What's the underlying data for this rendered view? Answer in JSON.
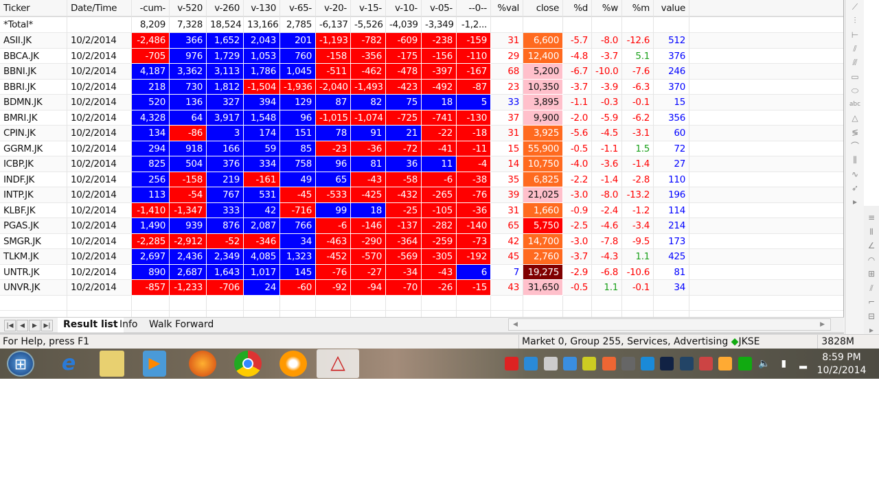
{
  "columns": [
    "Ticker",
    "Date/Time",
    "-cum-",
    "v-520",
    "v-260",
    "v-130",
    "v-65-",
    "v-20-",
    "v-15-",
    "v-10-",
    "v-05-",
    "--0--",
    "%val",
    "close",
    "%d",
    "%w",
    "%m",
    "value"
  ],
  "total": {
    "label": "*Total*",
    "values": [
      "8,209",
      "7,328",
      "18,524",
      "13,166",
      "2,785",
      "-6,137",
      "-5,526",
      "-4,039",
      "-3,349",
      "-1,2..."
    ]
  },
  "colors": {
    "positive_bg": "#0000ff",
    "negative_bg": "#ff0000",
    "orange": "#ff6a1f",
    "pink": "#ffc0cb",
    "red": "#ff0000",
    "darkred": "#800000",
    "blue_text": "#0000ff",
    "red_text": "#ff0000",
    "green_text": "#1aa01a"
  },
  "rows": [
    {
      "ticker": "ASII.JK",
      "date": "10/2/2014",
      "v": [
        "-2,486",
        "366",
        "1,652",
        "2,043",
        "201",
        "-1,193",
        "-782",
        "-609",
        "-238",
        "-159"
      ],
      "pval": "31",
      "pval_color": "red",
      "close": "6,600",
      "close_bg": "orange",
      "d": "-5.7",
      "w": "-8.0",
      "m": "-12.6",
      "value": "512"
    },
    {
      "ticker": "BBCA.JK",
      "date": "10/2/2014",
      "v": [
        "-705",
        "976",
        "1,729",
        "1,053",
        "760",
        "-158",
        "-356",
        "-175",
        "-156",
        "-110"
      ],
      "pval": "29",
      "pval_color": "red",
      "close": "12,400",
      "close_bg": "orange",
      "d": "-4.8",
      "w": "-3.7",
      "m": "5.1",
      "value": "376"
    },
    {
      "ticker": "BBNI.JK",
      "date": "10/2/2014",
      "v": [
        "4,187",
        "3,362",
        "3,113",
        "1,786",
        "1,045",
        "-511",
        "-462",
        "-478",
        "-397",
        "-167"
      ],
      "pval": "68",
      "pval_color": "red",
      "close": "5,200",
      "close_bg": "pink",
      "d": "-6.7",
      "w": "-10.0",
      "m": "-7.6",
      "value": "246"
    },
    {
      "ticker": "BBRI.JK",
      "date": "10/2/2014",
      "v": [
        "218",
        "730",
        "1,812",
        "-1,504",
        "-1,936",
        "-2,040",
        "-1,493",
        "-423",
        "-492",
        "-87"
      ],
      "pval": "23",
      "pval_color": "red",
      "close": "10,350",
      "close_bg": "pink",
      "d": "-3.7",
      "w": "-3.9",
      "m": "-6.3",
      "value": "370"
    },
    {
      "ticker": "BDMN.JK",
      "date": "10/2/2014",
      "v": [
        "520",
        "136",
        "327",
        "394",
        "129",
        "87",
        "82",
        "75",
        "18",
        "5"
      ],
      "pval": "33",
      "pval_color": "blue",
      "close": "3,895",
      "close_bg": "pink",
      "d": "-1.1",
      "w": "-0.3",
      "m": "-0.1",
      "value": "15"
    },
    {
      "ticker": "BMRI.JK",
      "date": "10/2/2014",
      "v": [
        "4,328",
        "64",
        "3,917",
        "1,548",
        "96",
        "-1,015",
        "-1,074",
        "-725",
        "-741",
        "-130"
      ],
      "pval": "37",
      "pval_color": "red",
      "close": "9,900",
      "close_bg": "pink",
      "d": "-2.0",
      "w": "-5.9",
      "m": "-6.2",
      "value": "356"
    },
    {
      "ticker": "CPIN.JK",
      "date": "10/2/2014",
      "v": [
        "134",
        "-86",
        "3",
        "174",
        "151",
        "78",
        "91",
        "21",
        "-22",
        "-18"
      ],
      "pval": "31",
      "pval_color": "red",
      "close": "3,925",
      "close_bg": "orange",
      "d": "-5.6",
      "w": "-4.5",
      "m": "-3.1",
      "value": "60"
    },
    {
      "ticker": "GGRM.JK",
      "date": "10/2/2014",
      "v": [
        "294",
        "918",
        "166",
        "59",
        "85",
        "-23",
        "-36",
        "-72",
        "-41",
        "-11"
      ],
      "pval": "15",
      "pval_color": "red",
      "close": "55,900",
      "close_bg": "orange",
      "d": "-0.5",
      "w": "-1.1",
      "m": "1.5",
      "value": "72"
    },
    {
      "ticker": "ICBP.JK",
      "date": "10/2/2014",
      "v": [
        "825",
        "504",
        "376",
        "334",
        "758",
        "96",
        "81",
        "36",
        "11",
        "-4"
      ],
      "pval": "14",
      "pval_color": "red",
      "close": "10,750",
      "close_bg": "orange",
      "d": "-4.0",
      "w": "-3.6",
      "m": "-1.4",
      "value": "27"
    },
    {
      "ticker": "INDF.JK",
      "date": "10/2/2014",
      "v": [
        "256",
        "-158",
        "219",
        "-161",
        "49",
        "65",
        "-43",
        "-58",
        "-6",
        "-38"
      ],
      "pval": "35",
      "pval_color": "red",
      "close": "6,825",
      "close_bg": "orange",
      "d": "-2.2",
      "w": "-1.4",
      "m": "-2.8",
      "value": "110"
    },
    {
      "ticker": "INTP.JK",
      "date": "10/2/2014",
      "v": [
        "113",
        "-54",
        "767",
        "531",
        "-45",
        "-533",
        "-425",
        "-432",
        "-265",
        "-76"
      ],
      "pval": "39",
      "pval_color": "red",
      "close": "21,025",
      "close_bg": "pink",
      "d": "-3.0",
      "w": "-8.0",
      "m": "-13.2",
      "value": "196"
    },
    {
      "ticker": "KLBF.JK",
      "date": "10/2/2014",
      "v": [
        "-1,410",
        "-1,347",
        "333",
        "42",
        "-716",
        "99",
        "18",
        "-25",
        "-105",
        "-36"
      ],
      "pval": "31",
      "pval_color": "red",
      "close": "1,660",
      "close_bg": "orange",
      "d": "-0.9",
      "w": "-2.4",
      "m": "-1.2",
      "value": "114"
    },
    {
      "ticker": "PGAS.JK",
      "date": "10/2/2014",
      "v": [
        "1,490",
        "939",
        "876",
        "2,087",
        "766",
        "-6",
        "-146",
        "-137",
        "-282",
        "-140"
      ],
      "pval": "65",
      "pval_color": "red",
      "close": "5,750",
      "close_bg": "red",
      "d": "-2.5",
      "w": "-4.6",
      "m": "-3.4",
      "value": "214"
    },
    {
      "ticker": "SMGR.JK",
      "date": "10/2/2014",
      "v": [
        "-2,285",
        "-2,912",
        "-52",
        "-346",
        "34",
        "-463",
        "-290",
        "-364",
        "-259",
        "-73"
      ],
      "pval": "42",
      "pval_color": "red",
      "close": "14,700",
      "close_bg": "orange",
      "d": "-3.0",
      "w": "-7.8",
      "m": "-9.5",
      "value": "173"
    },
    {
      "ticker": "TLKM.JK",
      "date": "10/2/2014",
      "v": [
        "2,697",
        "2,436",
        "2,349",
        "4,085",
        "1,323",
        "-452",
        "-570",
        "-569",
        "-305",
        "-192"
      ],
      "pval": "45",
      "pval_color": "red",
      "close": "2,760",
      "close_bg": "orange",
      "d": "-3.7",
      "w": "-4.3",
      "m": "1.1",
      "value": "425"
    },
    {
      "ticker": "UNTR.JK",
      "date": "10/2/2014",
      "v": [
        "890",
        "2,687",
        "1,643",
        "1,017",
        "145",
        "-76",
        "-27",
        "-34",
        "-43",
        "6"
      ],
      "pval": "7",
      "pval_color": "blue",
      "close": "19,275",
      "close_bg": "darkred",
      "d": "-2.9",
      "w": "-6.8",
      "m": "-10.6",
      "value": "81"
    },
    {
      "ticker": "UNVR.JK",
      "date": "10/2/2014",
      "v": [
        "-857",
        "-1,233",
        "-706",
        "24",
        "-60",
        "-92",
        "-94",
        "-70",
        "-26",
        "-15"
      ],
      "pval": "43",
      "pval_color": "red",
      "close": "31,650",
      "close_bg": "pink",
      "d": "-0.5",
      "w": "1.1",
      "m": "-0.1",
      "value": "34"
    }
  ],
  "tabs": [
    {
      "label": "Result list",
      "active": true
    },
    {
      "label": "Info"
    },
    {
      "label": "Walk Forward"
    }
  ],
  "status": {
    "help": "For Help, press F1",
    "market": "Market 0, Group 255, Services, Advertising",
    "index": "JKSE",
    "memory": "3828M"
  },
  "taskbar": {
    "apps": [
      "start-orb",
      "internet-explorer",
      "file-explorer",
      "media-player",
      "firefox",
      "chrome",
      "gom-player",
      "amibroker"
    ],
    "tray": [
      "avira",
      "teamviewer",
      "action-center",
      "dropbox",
      "network-tool",
      "google-drive",
      "display",
      "wifi",
      "bluetooth",
      "app",
      "app2",
      "app3",
      "amibroker-tray",
      "volume",
      "power",
      "signal"
    ],
    "time": "8:59 PM",
    "date": "10/2/2014"
  }
}
